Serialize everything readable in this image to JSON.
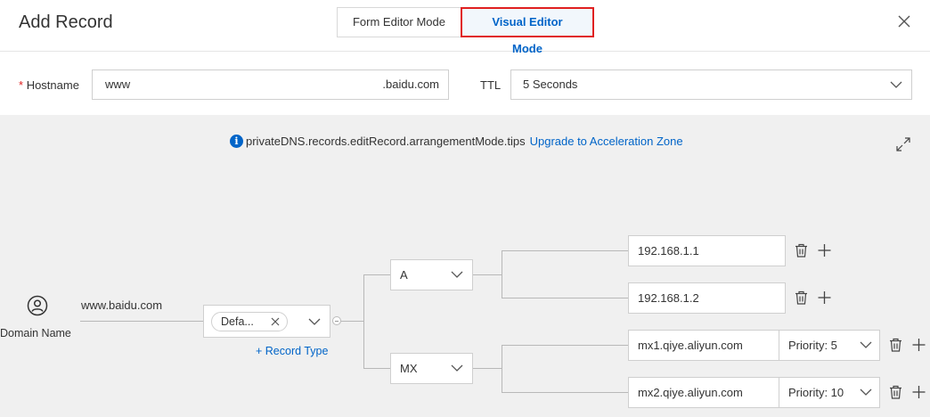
{
  "header": {
    "title": "Add Record",
    "tabs": [
      {
        "label": "Form Editor Mode",
        "active": false
      },
      {
        "label": "Visual Editor Mode",
        "active": true
      }
    ]
  },
  "form": {
    "hostname_label": "Hostname",
    "hostname_required_mark": "*",
    "hostname_value": "www",
    "hostname_suffix": ".baidu.com",
    "ttl_label": "TTL",
    "ttl_value": "5 Seconds"
  },
  "canvas": {
    "tips_text": "privateDNS.records.editRecord.arrangementMode.tips",
    "upgrade_link": "Upgrade to Acceleration Zone",
    "domain_label": "Domain Name",
    "domain_value": "www.baidu.com",
    "line_tag": "Defa...",
    "add_record_type": "+ Record Type",
    "record_types": [
      {
        "type": "A",
        "values": [
          {
            "value": "192.168.1.1"
          },
          {
            "value": "192.168.1.2"
          }
        ]
      },
      {
        "type": "MX",
        "values": [
          {
            "value": "mx1.qiye.aliyun.com",
            "priority": "Priority: 5"
          },
          {
            "value": "mx2.qiye.aliyun.com",
            "priority": "Priority: 10"
          }
        ]
      }
    ]
  },
  "colors": {
    "accent": "#0064c8",
    "highlight_border": "#e02020",
    "canvas_bg": "#f0f0f0"
  }
}
